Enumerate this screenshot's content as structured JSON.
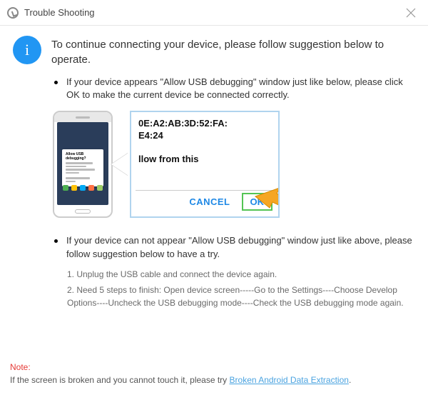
{
  "titlebar": {
    "title": "Trouble Shooting"
  },
  "intro": "To continue connecting your device, please follow suggestion below to operate.",
  "bullet1": "If your device appears \"Allow USB debugging\" window just like below, please click OK to make the current device  be connected correctly.",
  "phone_popup_title": "Allow USB debugging?",
  "zoom": {
    "rsa_line1": "0E:A2:AB:3D:52:FA:",
    "rsa_line2": "E4:24",
    "allow_text": "llow from this",
    "cancel": "CANCEL",
    "ok": "OK"
  },
  "bullet2": "If your device can not appear \"Allow USB debugging\" window just like above, please follow suggestion below to have a try.",
  "steps": {
    "s1": "1. Unplug the USB cable and connect the device again.",
    "s2": "2. Need 5 steps to finish: Open device screen-----Go to the Settings----Choose Develop Options----Uncheck the USB debugging mode----Check the USB debugging mode again."
  },
  "note": {
    "label": "Note:",
    "body_before": "If the screen is broken and you cannot touch it, please try ",
    "link": "Broken Android Data Extraction",
    "body_after": "."
  }
}
